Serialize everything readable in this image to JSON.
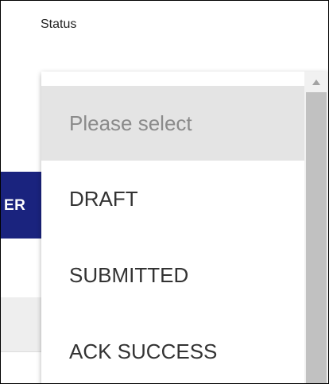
{
  "field": {
    "label": "Status"
  },
  "background": {
    "button_label_fragment": "ER",
    "button_color": "#1a237e"
  },
  "dropdown": {
    "placeholder": "Please select",
    "options": [
      {
        "label": "DRAFT"
      },
      {
        "label": "SUBMITTED"
      },
      {
        "label": "ACK SUCCESS"
      }
    ]
  },
  "scrollbar": {
    "up_icon": "triangle-up-icon"
  }
}
